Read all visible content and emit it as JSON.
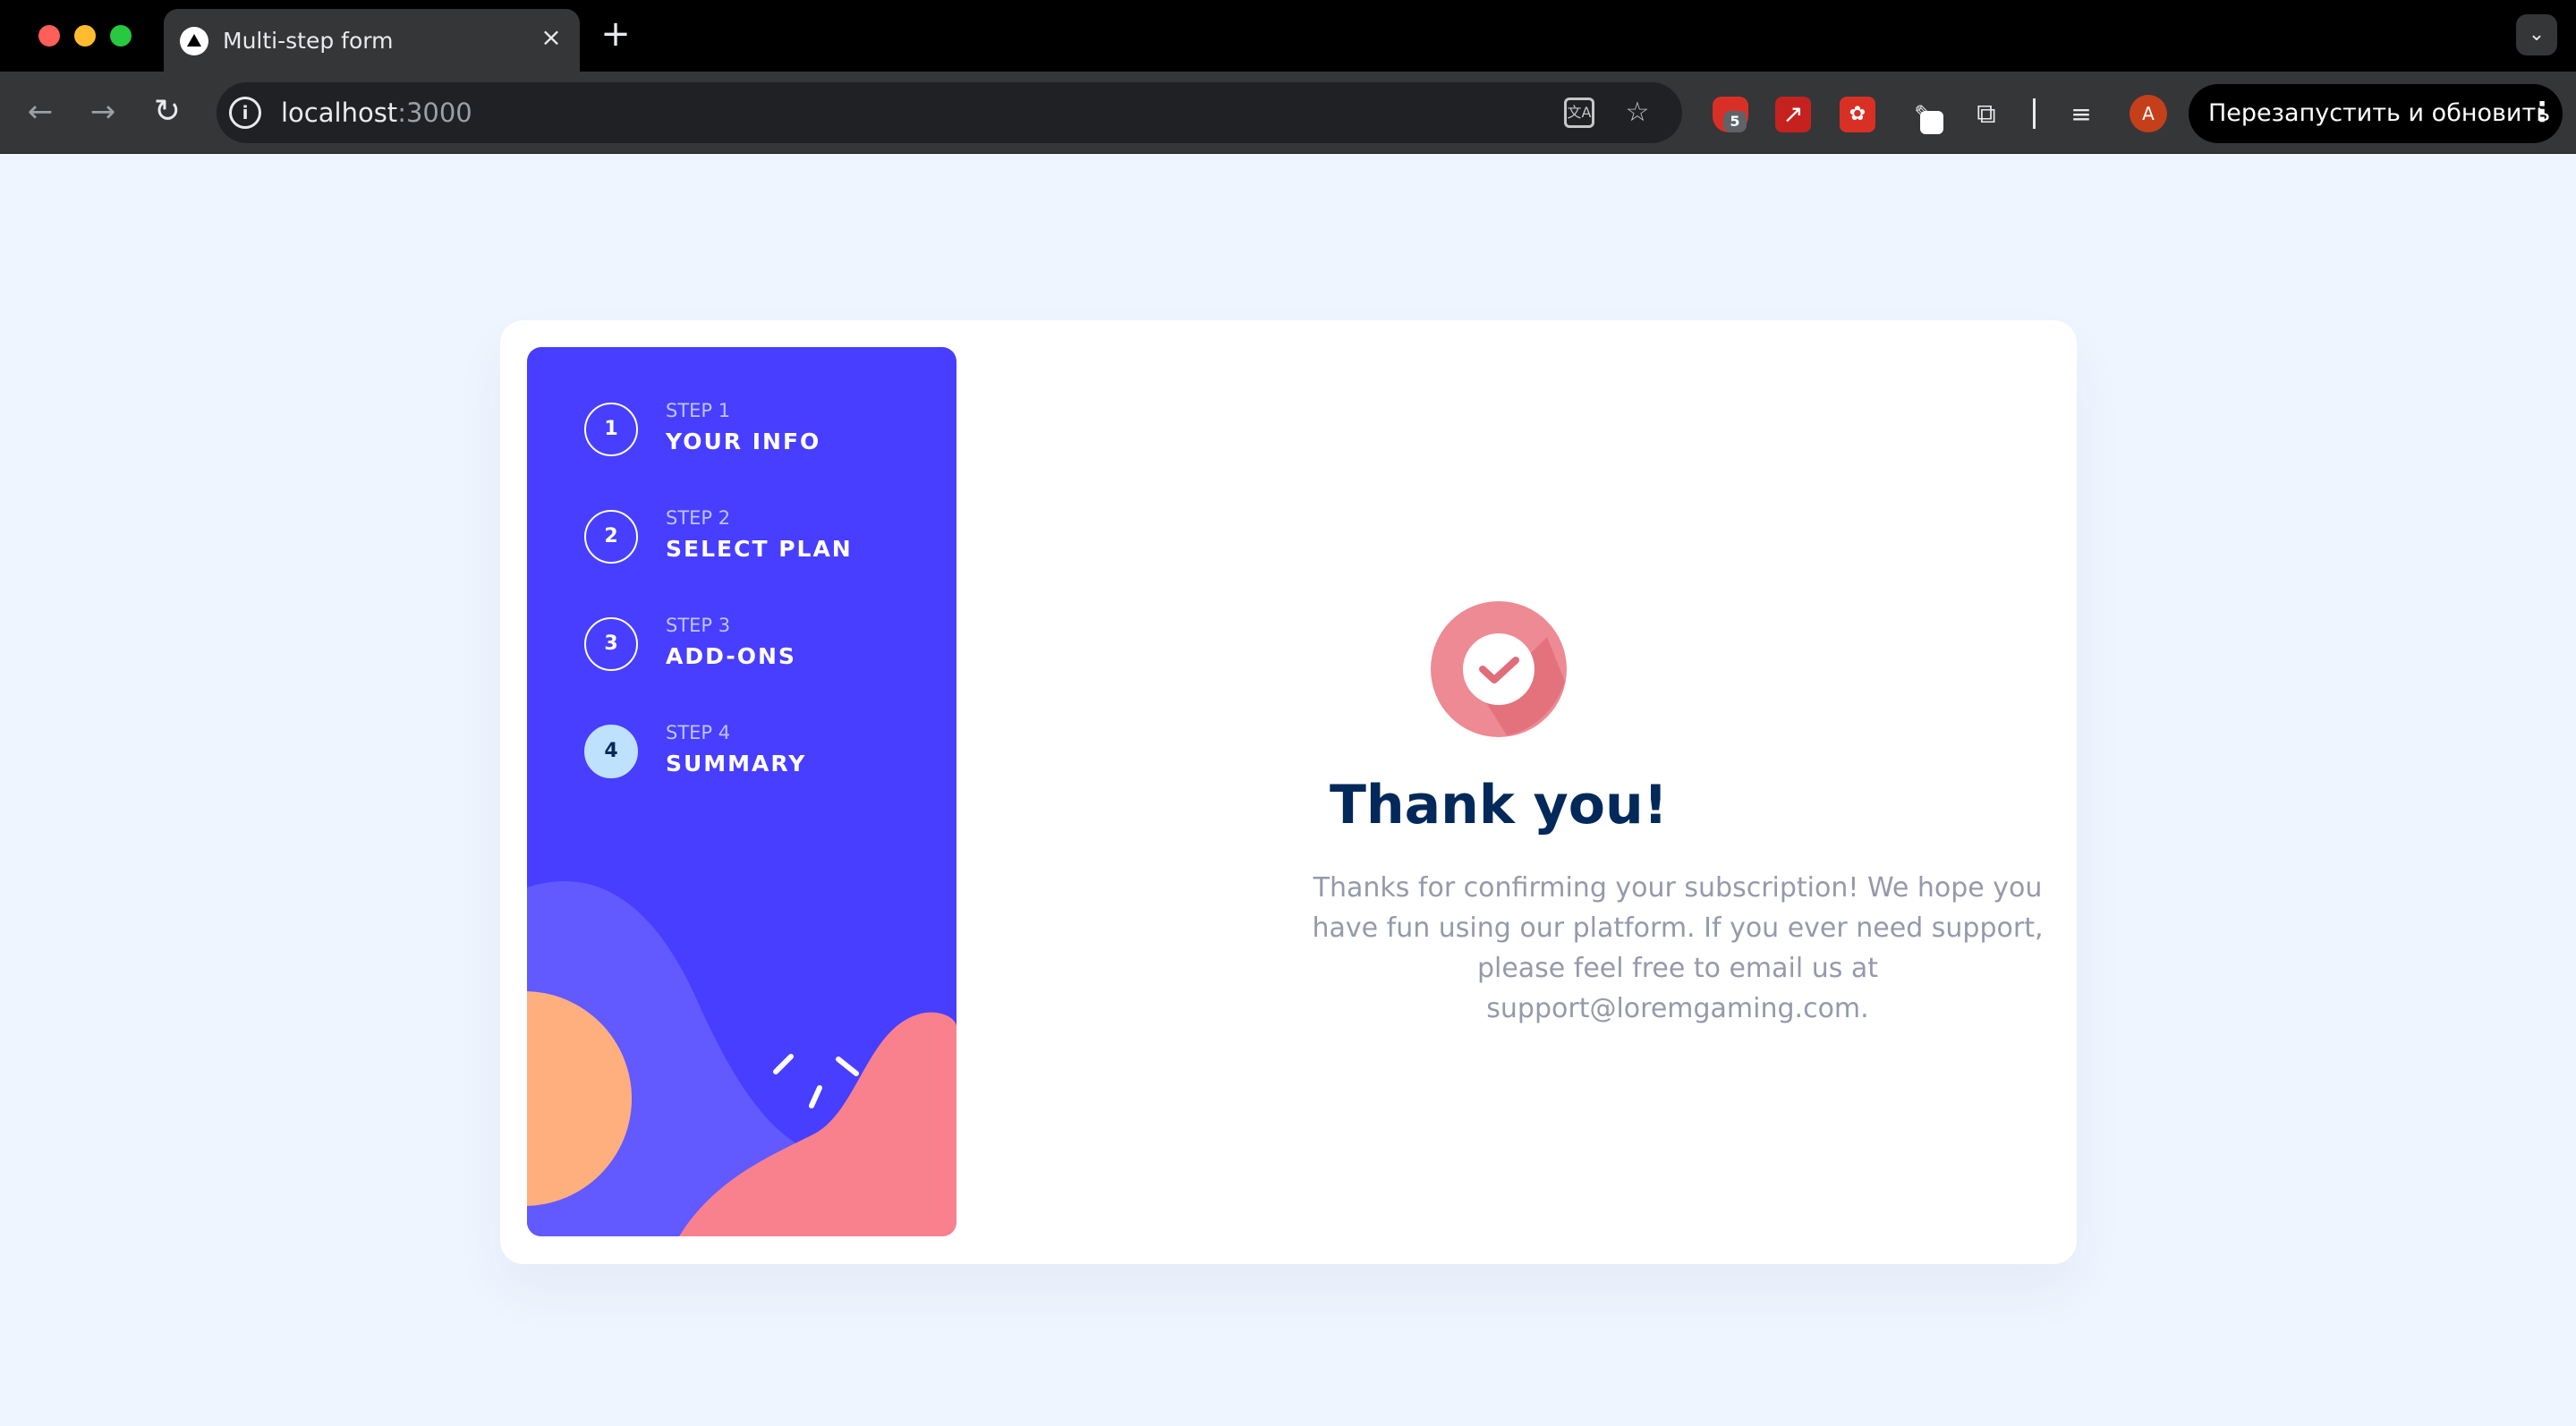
{
  "browser": {
    "tab_title": "Multi-step form",
    "tab_close": "×",
    "new_tab": "+",
    "tab_menu": "⌄",
    "url_host": "localhost",
    "url_port": ":3000",
    "extension_badge": "5",
    "avatar_letter": "A",
    "update_button_label": "Перезапустить и обновить"
  },
  "steps": [
    {
      "number": "1",
      "label": "STEP 1",
      "title": "YOUR INFO",
      "active": false
    },
    {
      "number": "2",
      "label": "STEP 2",
      "title": "SELECT PLAN",
      "active": false
    },
    {
      "number": "3",
      "label": "STEP 3",
      "title": "ADD-ONS",
      "active": false
    },
    {
      "number": "4",
      "label": "STEP 4",
      "title": "SUMMARY",
      "active": true
    }
  ],
  "confirmation": {
    "title": "Thank you!",
    "message": "Thanks for confirming your subscription! We hope you have fun using our platform. If you ever need support, please feel free to email us at support@loremgaming.com."
  },
  "colors": {
    "sidebar_bg": "#483eff",
    "active_step": "#bee2fd",
    "title": "#02295a",
    "text_muted": "#9699ab",
    "page_bg": "#eff5ff",
    "success_icon": "#f9818e"
  }
}
